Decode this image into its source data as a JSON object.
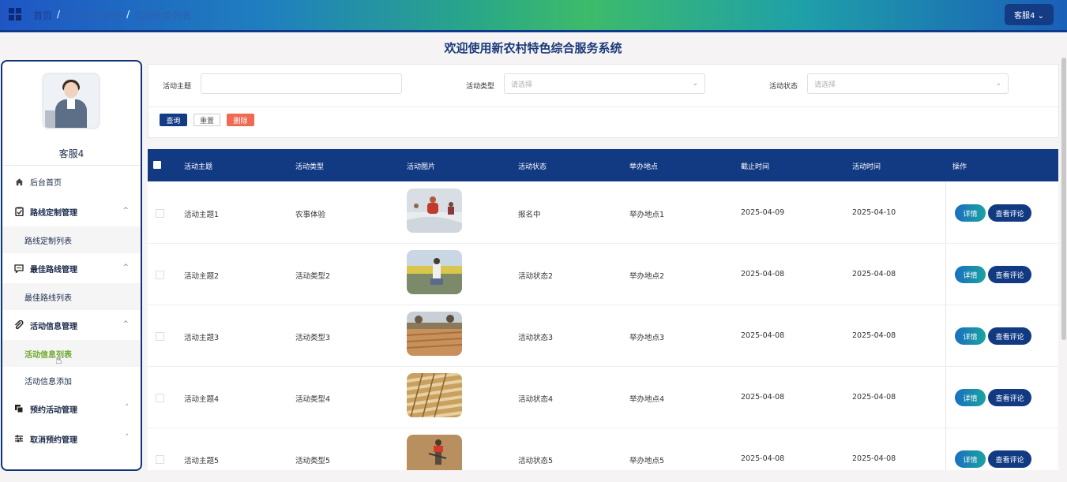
{
  "header": {
    "breadcrumb": [
      "首页",
      "活动信息管理",
      "活动信息列表"
    ],
    "separator": "/",
    "user_button": "客服4 ⌄"
  },
  "page_title": "欢迎使用新农村特色综合服务系统",
  "sidebar": {
    "username": "客服4",
    "items": [
      {
        "label": "后台首页",
        "icon": "home-icon"
      },
      {
        "label": "路线定制管理",
        "icon": "clipboard-check-icon",
        "expanded": true,
        "sub": [
          "路线定制列表"
        ]
      },
      {
        "label": "最佳路线管理",
        "icon": "message-icon",
        "expanded": true,
        "sub": [
          "最佳路线列表"
        ]
      },
      {
        "label": "活动信息管理",
        "icon": "paperclip-icon",
        "expanded": true,
        "sub": [
          "活动信息列表",
          "活动信息添加"
        ]
      },
      {
        "label": "预约活动管理",
        "icon": "copy-icon",
        "expanded": false
      },
      {
        "label": "取消预约管理",
        "icon": "sliders-icon",
        "expanded": false
      }
    ]
  },
  "search": {
    "topic_label": "活动主题",
    "topic_value": "",
    "type_label": "活动类型",
    "type_placeholder": "请选择",
    "status_label": "活动状态",
    "status_placeholder": "请选择",
    "query_button": "查询",
    "reset_button": "重置",
    "delete_button": "删除"
  },
  "table": {
    "headers": [
      "活动主题",
      "活动类型",
      "活动图片",
      "活动状态",
      "举办地点",
      "截止时间",
      "活动时间",
      "操作"
    ],
    "detail_button": "详情",
    "comments_button": "查看评论",
    "rows": [
      {
        "topic": "活动主题1",
        "type": "农事体验",
        "status": "报名中",
        "place": "举办地点1",
        "deadline": "2025-04-09",
        "time": "2025-04-10"
      },
      {
        "topic": "活动主题2",
        "type": "活动类型2",
        "status": "活动状态2",
        "place": "举办地点2",
        "deadline": "2025-04-08",
        "time": "2025-04-08"
      },
      {
        "topic": "活动主题3",
        "type": "活动类型3",
        "status": "活动状态3",
        "place": "举办地点3",
        "deadline": "2025-04-08",
        "time": "2025-04-08"
      },
      {
        "topic": "活动主题4",
        "type": "活动类型4",
        "status": "活动状态4",
        "place": "举办地点4",
        "deadline": "2025-04-08",
        "time": "2025-04-08"
      },
      {
        "topic": "活动主题5",
        "type": "活动类型5",
        "status": "活动状态5",
        "place": "举办地点5",
        "deadline": "2025-04-08",
        "time": "2025-04-08"
      }
    ]
  },
  "colors": {
    "nav": "#123a83",
    "accent_green": "#6da82b",
    "delete": "#ee6a52"
  }
}
